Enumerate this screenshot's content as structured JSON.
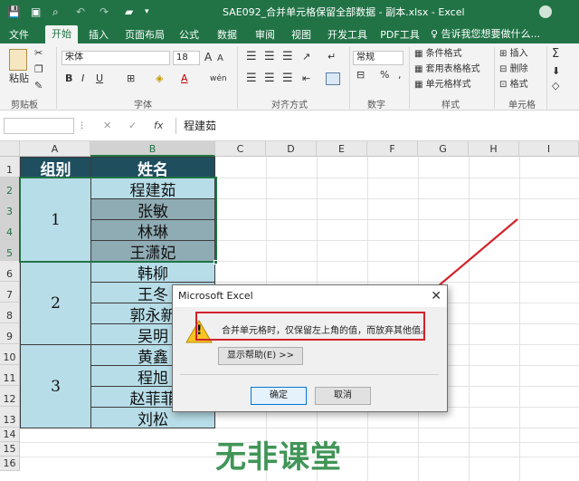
{
  "window": {
    "title": "SAE092_合并单元格保留全部数据 - 副本.xlsx - Excel",
    "qa_save": "💾",
    "qa_undo": "↶",
    "qa_redo": "↷"
  },
  "tabs": [
    {
      "label": "文件"
    },
    {
      "label": "开始"
    },
    {
      "label": "插入"
    },
    {
      "label": "页面布局"
    },
    {
      "label": "公式"
    },
    {
      "label": "数据"
    },
    {
      "label": "审阅"
    },
    {
      "label": "视图"
    },
    {
      "label": "开发工具"
    },
    {
      "label": "PDF工具"
    }
  ],
  "tell_me": "♀ 告诉我您想要做什么...",
  "ribbon": {
    "clipboard": {
      "paste": "粘贴",
      "label": "剪贴板"
    },
    "font": {
      "name": "宋体",
      "size": "18",
      "label": "字体",
      "bold": "B",
      "italic": "I",
      "underline": "U",
      "wen": "wén"
    },
    "alignment": {
      "label": "对齐方式"
    },
    "number": {
      "format": "常规",
      "label": "数字",
      "percent": "%",
      "comma": ","
    },
    "styles": {
      "conditional": "条件格式",
      "table": "套用表格格式",
      "cell": "单元格样式",
      "label": "样式"
    },
    "cells": {
      "insert": "插入",
      "delete": "删除",
      "format": "格式",
      "label": "单元格"
    },
    "editing": {
      "sum": "Σ"
    }
  },
  "formula_bar": {
    "content": "程建茹",
    "fx": "fx",
    "cancel": "✕",
    "enter": "✓"
  },
  "columns": [
    "A",
    "B",
    "C",
    "D",
    "E",
    "F",
    "G",
    "H",
    "I"
  ],
  "rows": [
    "1",
    "2",
    "3",
    "4",
    "5",
    "6",
    "7",
    "8",
    "9",
    "10",
    "11",
    "12",
    "13",
    "14",
    "15",
    "16"
  ],
  "table": {
    "header_group": "组别",
    "header_name": "姓名",
    "groups": [
      {
        "label": "1",
        "names": [
          "程建茹",
          "张敏",
          "林琳",
          "王潇妃"
        ]
      },
      {
        "label": "2",
        "names": [
          "韩柳",
          "王冬",
          "郭永新",
          "吴明"
        ]
      },
      {
        "label": "3",
        "names": [
          "黄鑫",
          "程旭",
          "赵菲菲",
          "刘松"
        ]
      }
    ]
  },
  "dialog": {
    "title": "Microsoft Excel",
    "close": "✕",
    "message": "合并单元格时，仅保留左上角的值，而放弃其他值。",
    "help_button": "显示帮助(E) >>",
    "ok_button": "确定",
    "cancel_button": "取消",
    "warning_glyph": "!"
  },
  "watermark": "无非课堂",
  "colors": {
    "excel_green": "#217346",
    "header_fill": "#1f4e5f",
    "cell_fill": "#b7dde8",
    "annotation_red": "#d1232a"
  }
}
